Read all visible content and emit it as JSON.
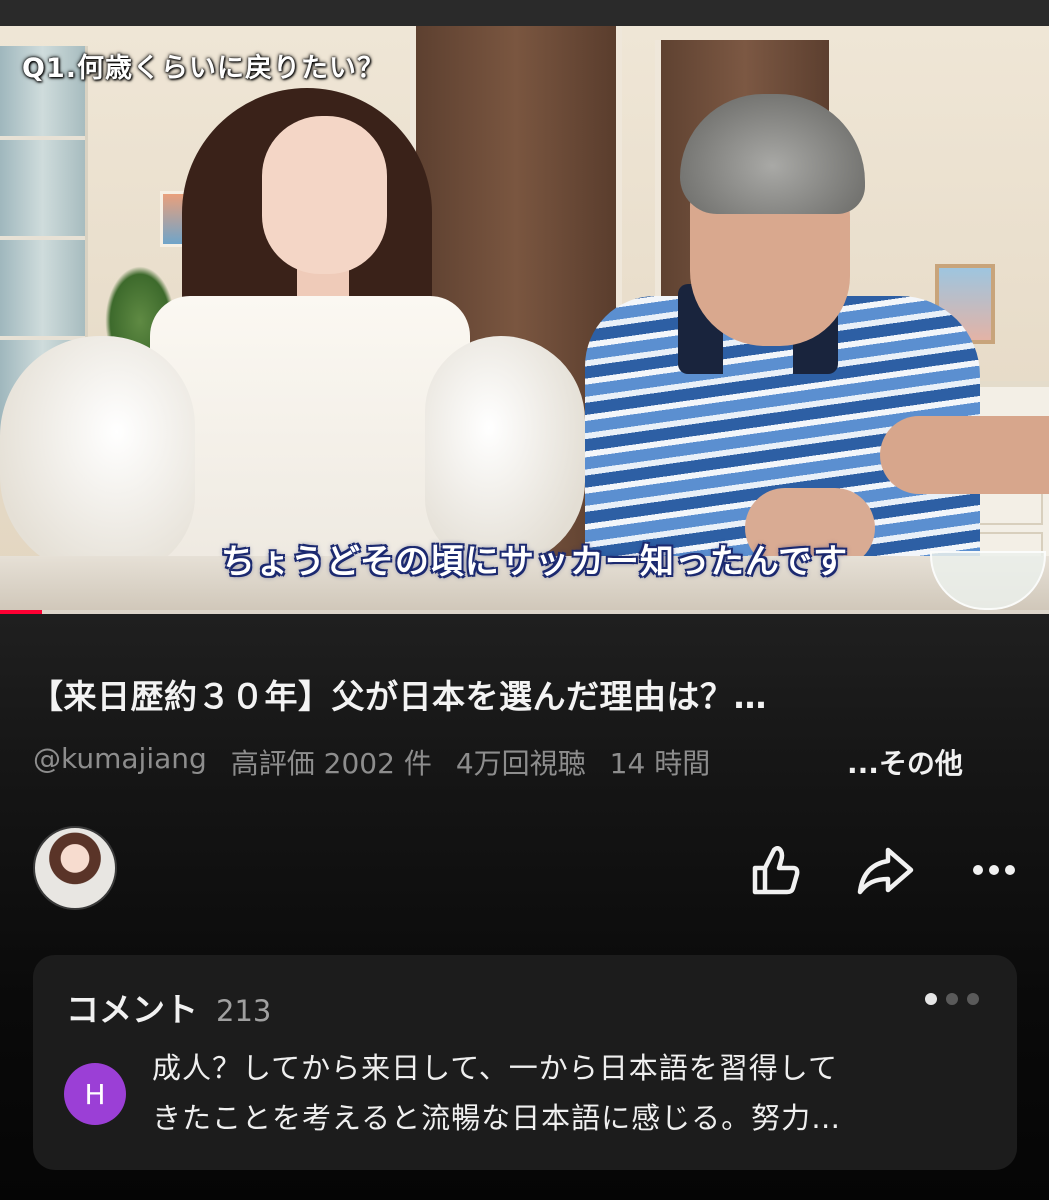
{
  "video": {
    "caption_top": "Q1.何歳くらいに戻りたい？",
    "subtitle": "ちょうどその頃にサッカー知ったんです",
    "progress_fraction": 0.04,
    "progress_color": "#ff0033"
  },
  "info": {
    "title": "【来日歴約３０年】父が日本を選んだ理由は？…",
    "channel": "@kumajiang",
    "likes": "高評価 2002 件",
    "views": "4万回視聴",
    "time": "14 時間",
    "more": "...その他"
  },
  "actions": {
    "like_icon": "thumbs-up-icon",
    "share_icon": "share-icon",
    "more_icon": "more-horizontal-icon"
  },
  "comments": {
    "label": "コメント",
    "count": "213",
    "avatar_letter": "H",
    "avatar_color": "#9b3fd6",
    "top_comment_line1": "成人？してから来日して、一から日本語を習得して",
    "top_comment_line2": "きたことを考えると流暢な日本語に感じる。努力…",
    "page_dots": 3,
    "active_dot": 0
  }
}
